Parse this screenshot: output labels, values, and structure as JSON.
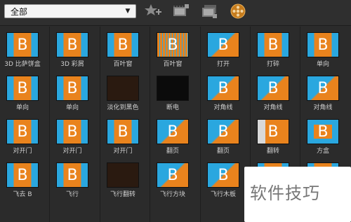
{
  "toolbar": {
    "category_select": {
      "value": "全部"
    },
    "icons": [
      "favorite-add-icon",
      "film-clip-icon",
      "film-clip-stack-icon",
      "film-reel-icon"
    ]
  },
  "transitions": [
    {
      "label": "3D 比萨饼盒"
    },
    {
      "label": "3D 彩屑"
    },
    {
      "label": "百叶窗"
    },
    {
      "label": "百叶窗"
    },
    {
      "label": "打开"
    },
    {
      "label": "打碎"
    },
    {
      "label": "单向"
    },
    {
      "label": "单向"
    },
    {
      "label": "单向"
    },
    {
      "label": "淡化到黑色"
    },
    {
      "label": "断电"
    },
    {
      "label": "对角线"
    },
    {
      "label": "对角线"
    },
    {
      "label": "对角线"
    },
    {
      "label": "对开门"
    },
    {
      "label": "对开门"
    },
    {
      "label": "对开门"
    },
    {
      "label": "翻页"
    },
    {
      "label": "翻页"
    },
    {
      "label": "翻转"
    },
    {
      "label": "方盒"
    },
    {
      "label": "飞去 B"
    },
    {
      "label": "飞行"
    },
    {
      "label": "飞行翻转"
    },
    {
      "label": "飞行方块"
    },
    {
      "label": "飞行木板"
    },
    {
      "label": ""
    },
    {
      "label": ""
    }
  ],
  "thumb_glyph": "B",
  "watermark": {
    "text": "软件技巧"
  },
  "colors": {
    "orange": "#e9831d",
    "blue": "#2aa7df",
    "panel": "#2b2b2b"
  }
}
